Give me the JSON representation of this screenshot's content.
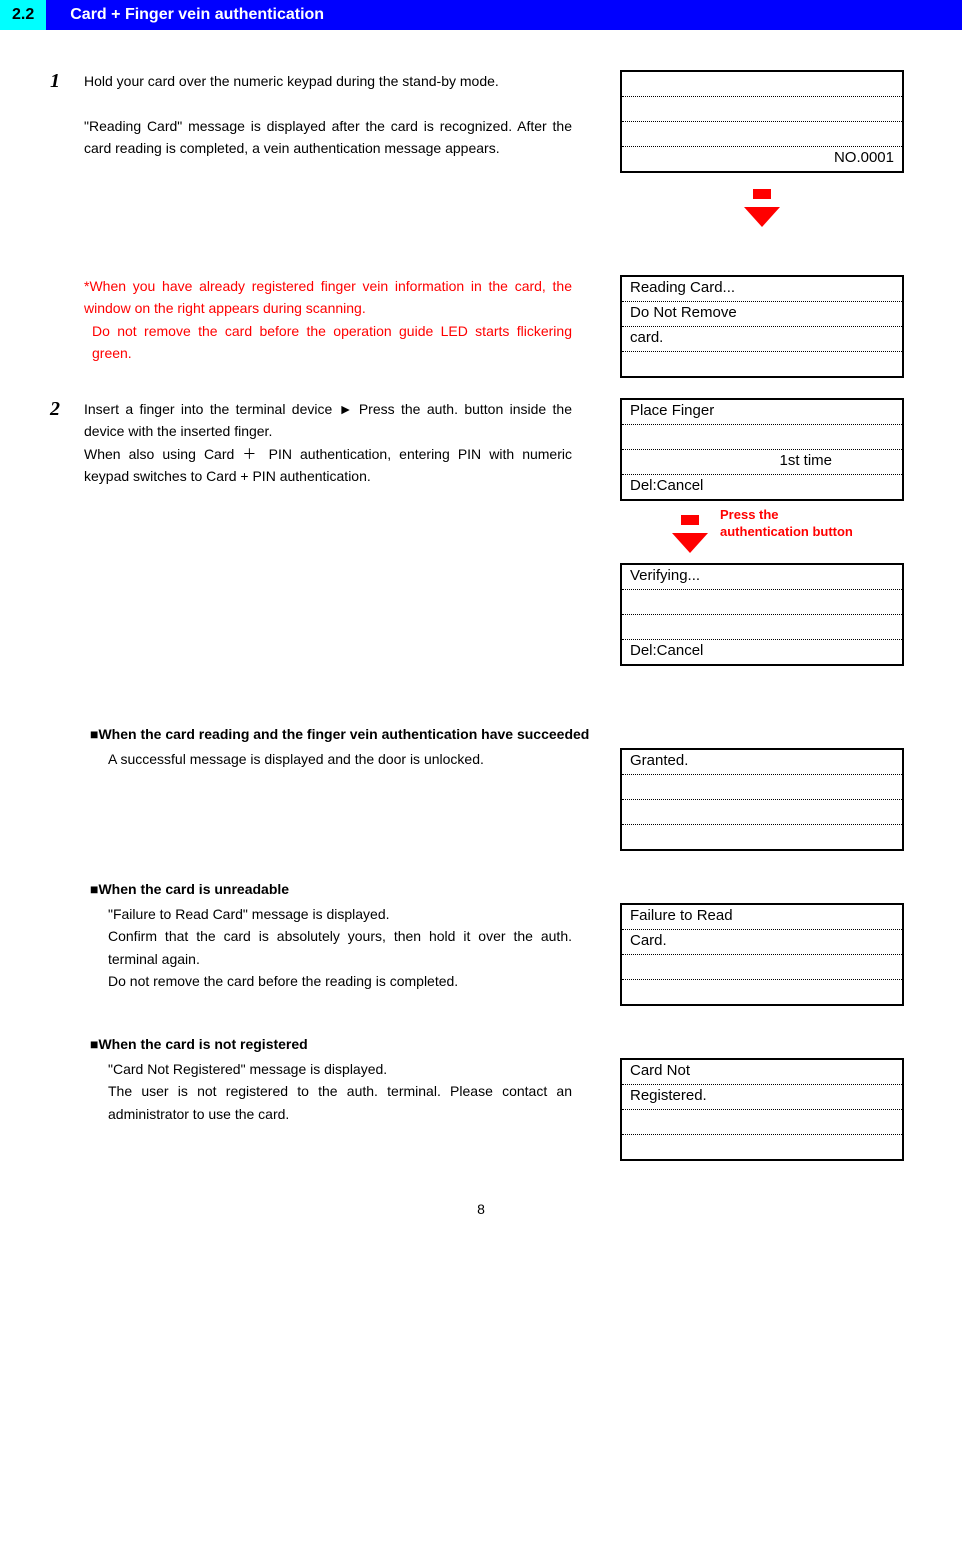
{
  "section": {
    "number": "2.2",
    "title": "Card + Finger vein authentication"
  },
  "step1": {
    "num": "1",
    "para1": "Hold your card over the numeric keypad during the stand-by mode.",
    "para2": "\"Reading Card\" message is displayed after the card is recognized. After the card reading is completed, a vein authentication message appears."
  },
  "lcd_standby": {
    "line4": "NO.0001"
  },
  "note_red": {
    "line1": "*When you have already registered finger vein information in the card, the window on the right appears during scanning.",
    "line2": "Do not remove the card before the operation guide LED starts flickering green."
  },
  "lcd_reading": {
    "line1": "Reading Card...",
    "line2": "Do Not Remove",
    "line3": "card."
  },
  "step2": {
    "num": "2",
    "para1": "Insert a finger into the terminal device ► Press the auth. button inside the device with the inserted finger.",
    "para2": "When also using Card ＋ PIN authentication, entering PIN with numeric keypad switches to Card + PIN authentication."
  },
  "lcd_place": {
    "line1": "Place Finger",
    "line3": "1st time",
    "line4": "Del:Cancel"
  },
  "arrow_label": {
    "line1": "Press the",
    "line2": "authentication button"
  },
  "lcd_verify": {
    "line1": "Verifying...",
    "line4": "Del:Cancel"
  },
  "sub_success": {
    "heading": "■When the card reading and the finger vein authentication have succeeded",
    "text": "A successful message is displayed and the door is unlocked."
  },
  "lcd_granted": {
    "line1": "Granted."
  },
  "sub_unreadable": {
    "heading": "■When the card is unreadable",
    "text1": "\"Failure to Read Card\" message is displayed.",
    "text2": "Confirm that the card is absolutely yours, then hold it over the auth. terminal again.",
    "text3": "Do not remove the card before the reading is completed."
  },
  "lcd_failure": {
    "line1": "Failure to Read",
    "line2": "Card."
  },
  "sub_notreg": {
    "heading": "■When the card is not registered",
    "text1": "\"Card Not Registered\" message is displayed.",
    "text2": "The user is not registered to the auth. terminal. Please contact an administrator to use the card."
  },
  "lcd_notreg": {
    "line1": "Card Not",
    "line2": "Registered."
  },
  "page_number": "8"
}
